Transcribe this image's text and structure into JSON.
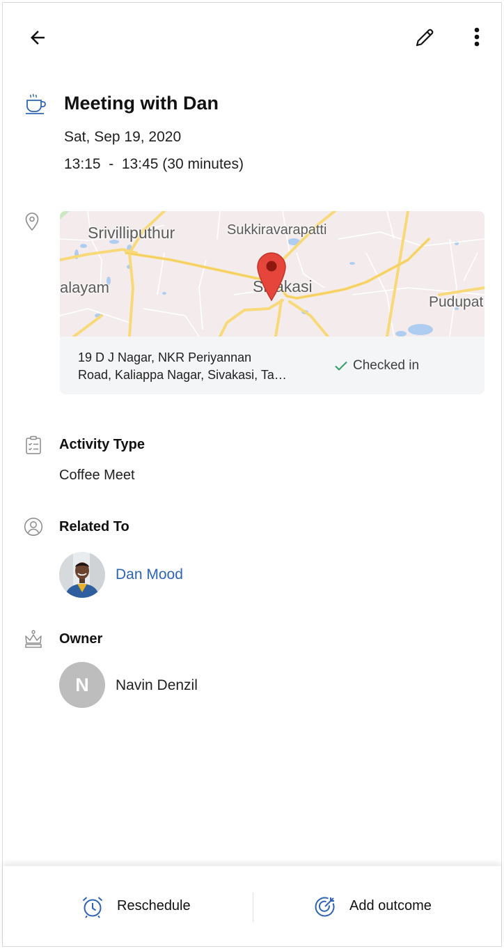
{
  "header": {
    "back_icon": "arrow-left-icon",
    "edit_icon": "pencil-icon",
    "more_icon": "more-vert-icon"
  },
  "event": {
    "icon": "coffee-cup-icon",
    "title": "Meeting with Dan",
    "date": "Sat, Sep 19, 2020",
    "time": "13:15  -  13:45 (30 minutes)"
  },
  "location": {
    "icon": "location-pin-icon",
    "map_labels": {
      "srivilliputhur": "Srivilliputhur",
      "sukkiravarapatti": "Sukkiravarapatti",
      "alayam": "alayam",
      "sivakasi": "Sivakasi",
      "pudupat": "Pudupat"
    },
    "address_line1": "19 D J Nagar, NKR Periyannan",
    "address_line2": "Road, Kaliappa Nagar, Sivakasi, Tamil Nadu",
    "status": "Checked in",
    "status_color": "#2e9d6a"
  },
  "activity": {
    "icon": "checklist-icon",
    "label": "Activity Type",
    "value": "Coffee Meet"
  },
  "related": {
    "icon": "person-circle-icon",
    "label": "Related To",
    "name": "Dan Mood",
    "link_color": "#2f64b5"
  },
  "owner": {
    "icon": "crown-icon",
    "label": "Owner",
    "initial": "N",
    "name": "Navin Denzil"
  },
  "footer": {
    "reschedule_icon": "alarm-clock-icon",
    "reschedule_label": "Reschedule",
    "outcome_icon": "target-icon",
    "outcome_label": "Add outcome",
    "accent": "#2f64b5"
  }
}
